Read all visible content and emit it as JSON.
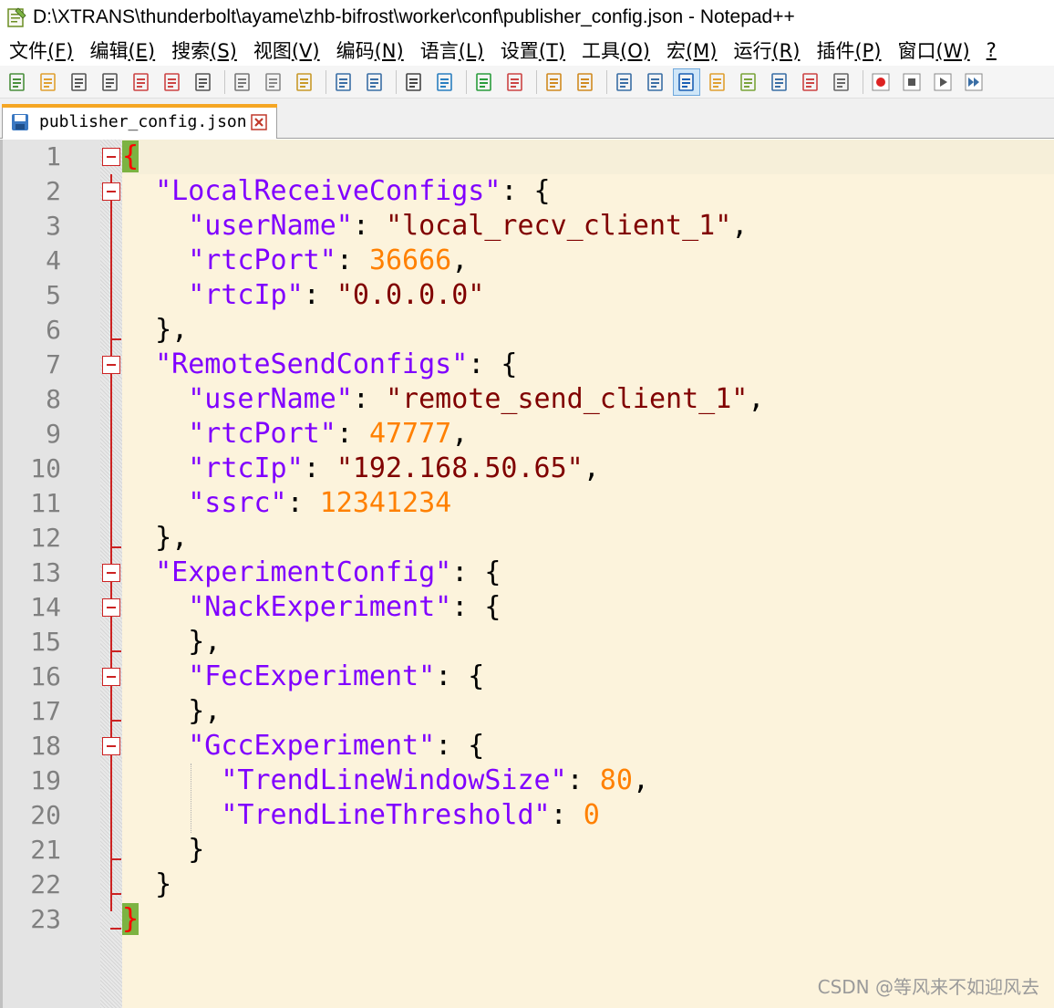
{
  "window": {
    "title": "D:\\XTRANS\\thunderbolt\\ayame\\zhb-bifrost\\worker\\conf\\publisher_config.json - Notepad++"
  },
  "menu": [
    {
      "label": "文件",
      "acc": "(F)"
    },
    {
      "label": "编辑",
      "acc": "(E)"
    },
    {
      "label": "搜索",
      "acc": "(S)"
    },
    {
      "label": "视图",
      "acc": "(V)"
    },
    {
      "label": "编码",
      "acc": "(N)"
    },
    {
      "label": "语言",
      "acc": "(L)"
    },
    {
      "label": "设置",
      "acc": "(T)"
    },
    {
      "label": "工具",
      "acc": "(O)"
    },
    {
      "label": "宏",
      "acc": "(M)"
    },
    {
      "label": "运行",
      "acc": "(R)"
    },
    {
      "label": "插件",
      "acc": "(P)"
    },
    {
      "label": "窗口",
      "acc": "(W)"
    },
    {
      "label": "",
      "acc": "?"
    }
  ],
  "toolbar": {
    "icons": [
      "new-file-icon",
      "open-file-icon",
      "save-icon",
      "save-all-icon",
      "close-icon",
      "close-all-icon",
      "print-icon",
      "cut-icon",
      "copy-icon",
      "paste-icon",
      "undo-icon",
      "redo-icon",
      "find-icon",
      "replace-icon",
      "zoom-in-icon",
      "zoom-out-icon",
      "sync-vertical-icon",
      "sync-horizontal-icon",
      "word-wrap-icon",
      "show-all-chars-icon",
      "indent-guide-icon",
      "user-lang-icon",
      "doc-map-icon",
      "function-list-icon",
      "folder-workspace-icon",
      "monitoring-icon",
      "record-macro-icon",
      "stop-macro-icon",
      "play-macro-icon",
      "run-macro-multiple-icon"
    ],
    "active_index": 20
  },
  "tab": {
    "label": "publisher_config.json"
  },
  "editor": {
    "lines": [
      [
        {
          "t": "{",
          "c": "bh"
        }
      ],
      [
        {
          "t": "  "
        },
        {
          "t": "\"LocalReceiveConfigs\"",
          "c": "k"
        },
        {
          "t": ": {"
        }
      ],
      [
        {
          "t": "    "
        },
        {
          "t": "\"userName\"",
          "c": "k"
        },
        {
          "t": ": "
        },
        {
          "t": "\"local_recv_client_1\"",
          "c": "s"
        },
        {
          "t": ","
        }
      ],
      [
        {
          "t": "    "
        },
        {
          "t": "\"rtcPort\"",
          "c": "k"
        },
        {
          "t": ": "
        },
        {
          "t": "36666",
          "c": "n"
        },
        {
          "t": ","
        }
      ],
      [
        {
          "t": "    "
        },
        {
          "t": "\"rtcIp\"",
          "c": "k"
        },
        {
          "t": ": "
        },
        {
          "t": "\"0.0.0.0\"",
          "c": "s"
        }
      ],
      [
        {
          "t": "  },"
        }
      ],
      [
        {
          "t": "  "
        },
        {
          "t": "\"RemoteSendConfigs\"",
          "c": "k"
        },
        {
          "t": ": {"
        }
      ],
      [
        {
          "t": "    "
        },
        {
          "t": "\"userName\"",
          "c": "k"
        },
        {
          "t": ": "
        },
        {
          "t": "\"remote_send_client_1\"",
          "c": "s"
        },
        {
          "t": ","
        }
      ],
      [
        {
          "t": "    "
        },
        {
          "t": "\"rtcPort\"",
          "c": "k"
        },
        {
          "t": ": "
        },
        {
          "t": "47777",
          "c": "n"
        },
        {
          "t": ","
        }
      ],
      [
        {
          "t": "    "
        },
        {
          "t": "\"rtcIp\"",
          "c": "k"
        },
        {
          "t": ": "
        },
        {
          "t": "\"192.168.50.65\"",
          "c": "s"
        },
        {
          "t": ","
        }
      ],
      [
        {
          "t": "    "
        },
        {
          "t": "\"ssrc\"",
          "c": "k"
        },
        {
          "t": ": "
        },
        {
          "t": "12341234",
          "c": "n"
        }
      ],
      [
        {
          "t": "  },"
        }
      ],
      [
        {
          "t": "  "
        },
        {
          "t": "\"ExperimentConfig\"",
          "c": "k"
        },
        {
          "t": ": {"
        }
      ],
      [
        {
          "t": "    "
        },
        {
          "t": "\"NackExperiment\"",
          "c": "k"
        },
        {
          "t": ": {"
        }
      ],
      [
        {
          "t": "    },"
        }
      ],
      [
        {
          "t": "    "
        },
        {
          "t": "\"FecExperiment\"",
          "c": "k"
        },
        {
          "t": ": {"
        }
      ],
      [
        {
          "t": "    },"
        }
      ],
      [
        {
          "t": "    "
        },
        {
          "t": "\"GccExperiment\"",
          "c": "k"
        },
        {
          "t": ": {"
        }
      ],
      [
        {
          "t": "      "
        },
        {
          "t": "\"TrendLineWindowSize\"",
          "c": "k"
        },
        {
          "t": ": "
        },
        {
          "t": "80",
          "c": "n"
        },
        {
          "t": ","
        }
      ],
      [
        {
          "t": "      "
        },
        {
          "t": "\"TrendLineThreshold\"",
          "c": "k"
        },
        {
          "t": ": "
        },
        {
          "t": "0",
          "c": "n"
        }
      ],
      [
        {
          "t": "    }"
        }
      ],
      [
        {
          "t": "  }"
        }
      ],
      [
        {
          "t": "}",
          "c": "bh"
        }
      ]
    ],
    "fold_lines": [
      1,
      2,
      7,
      13,
      14,
      16,
      18
    ]
  },
  "watermark": "CSDN @等风来不如迎风去",
  "colors": {
    "key": "#8000ff",
    "string": "#800000",
    "number": "#ff8000",
    "brace_highlight_bg": "#7cb342",
    "brace_highlight_fg": "#ff0000",
    "editor_bg": "#fcf3dc"
  }
}
